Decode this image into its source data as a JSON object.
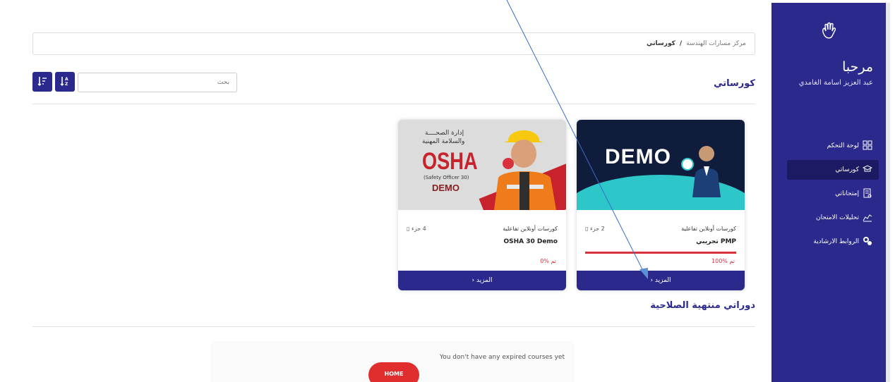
{
  "sidebar": {
    "greeting": "مرحبا",
    "user_name": "عبد العزيز اسامة الغامدي",
    "wave_icon": "waving-hand-icon",
    "items": [
      {
        "label": "لوحة التحكم",
        "icon": "dashboard-grid-icon",
        "active": false
      },
      {
        "label": "كورساتي",
        "icon": "graduation-cap-icon",
        "active": true
      },
      {
        "label": "إمتحاناتي",
        "icon": "exam-document-icon",
        "active": false
      },
      {
        "label": "تحليلات الامتحان",
        "icon": "chart-analytics-icon",
        "active": false
      },
      {
        "label": "الروابط الارشادية",
        "icon": "link-icon",
        "active": false
      }
    ]
  },
  "breadcrumb": {
    "root": "مركز مسارات الهندسة",
    "separator": "/",
    "current": "كورساتي"
  },
  "page_title": "كورساتي",
  "search": {
    "placeholder": "بحث"
  },
  "courses": [
    {
      "type": "كورسات أونلاين تفاعلية",
      "parts": "2 جزء",
      "name": "PMP تجريبي",
      "progress_pct": 100,
      "progress_label": "100% تم",
      "show_bar": true,
      "more_label": "المزيد ‹",
      "thumb_text": "DEMO"
    },
    {
      "type": "كورسات أونلاين تفاعلية",
      "parts": "4 جزء",
      "name": "OSHA 30 Demo",
      "progress_pct": 0,
      "progress_label": "0% تم",
      "show_bar": false,
      "more_label": "المزيد ‹",
      "thumb_line1": "إدارة الصحــــة",
      "thumb_line2": "والسلامة المهنية",
      "thumb_big": "OSHA",
      "thumb_sub": "(Safety Officer 30)",
      "thumb_demo": "DEMO"
    }
  ],
  "expired_section": {
    "title": "دوراتي منتهية الصلاحية",
    "message": "You don't have any expired courses yet",
    "home_label": "HOME"
  },
  "colors": {
    "primary": "#2b2a8c",
    "accent": "#d9323c",
    "teal": "#2ec7c9"
  }
}
